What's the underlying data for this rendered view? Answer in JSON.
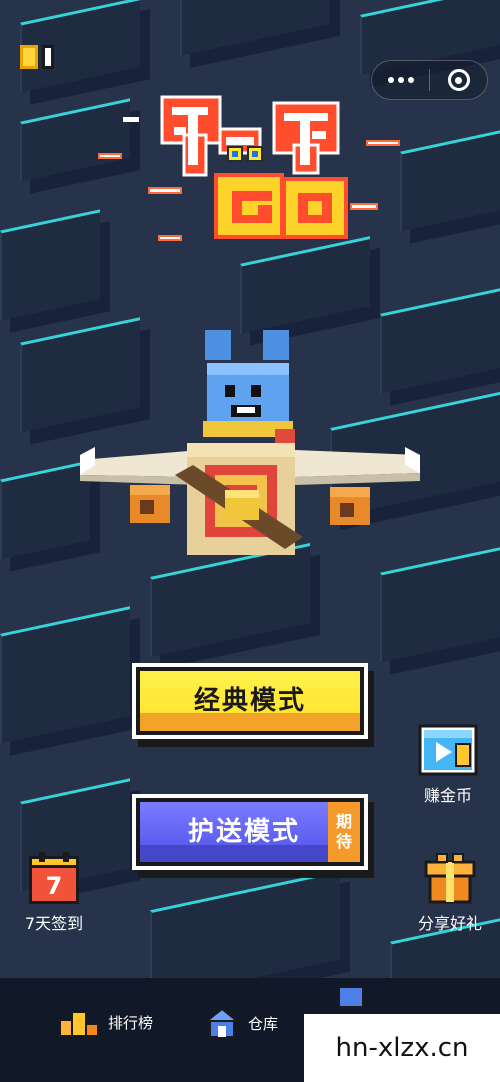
{
  "buttons": {
    "classic_mode": "经典模式",
    "escort_mode": "护送模式",
    "escort_badge_top": "期",
    "escort_badge_bottom": "待"
  },
  "side": {
    "earn_coins": "赚金币",
    "share_gift": "分享好礼",
    "checkin_label": "7天签到",
    "checkin_day": "7"
  },
  "nav": {
    "rank": "排行榜",
    "store": "仓库"
  },
  "watermark": "hn-xlzx.cn",
  "colors": {
    "accent_yellow": "#ffe633",
    "accent_purple": "#5b5df0",
    "accent_orange": "#f39a2a",
    "edge_cyan": "#36d3d9"
  }
}
